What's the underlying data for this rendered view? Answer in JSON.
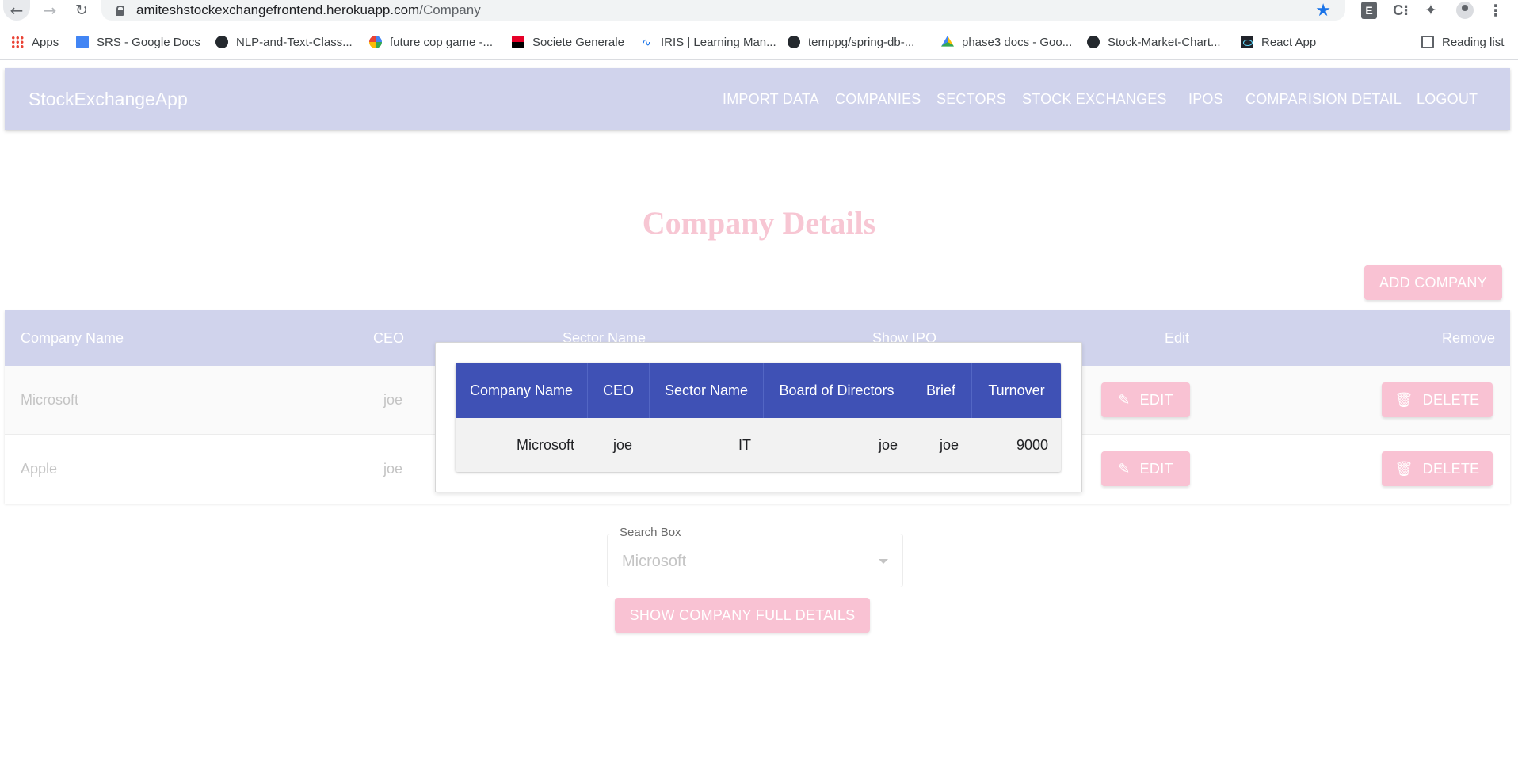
{
  "browser": {
    "url_host": "amiteshstockexchangefrontend.herokuapp.com",
    "url_path": "/Company",
    "extensions": [
      "E",
      "C⁝"
    ],
    "bookmarks": [
      {
        "label": "Apps",
        "icon": "apps-icon"
      },
      {
        "label": "SRS - Google Docs",
        "icon": "google-docs-icon"
      },
      {
        "label": "NLP-and-Text-Class...",
        "icon": "github-icon"
      },
      {
        "label": "future cop game -...",
        "icon": "google-icon"
      },
      {
        "label": "Societe Generale",
        "icon": "societe-generale-icon"
      },
      {
        "label": "IRIS | Learning Man...",
        "icon": "iris-icon"
      },
      {
        "label": "temppg/spring-db-...",
        "icon": "github-icon"
      },
      {
        "label": "phase3 docs - Goo...",
        "icon": "google-drive-icon"
      },
      {
        "label": "Stock-Market-Chart...",
        "icon": "github-icon"
      },
      {
        "label": "React App",
        "icon": "react-icon"
      }
    ],
    "reading_list": "Reading list"
  },
  "app": {
    "brand": "StockExchangeApp",
    "nav": [
      "IMPORT DATA",
      "COMPANIES",
      "SECTORS",
      "STOCK EXCHANGES",
      "IPOS",
      "COMPARISION DETAIL",
      "LOGOUT"
    ],
    "accent_color": "#d0d3ec",
    "button_color": "#f9c2d3"
  },
  "page": {
    "title": "Company Details",
    "add_button": "ADD COMPANY"
  },
  "table": {
    "headers": [
      "Company Name",
      "CEO",
      "Sector Name",
      "Show IPO",
      "Edit",
      "Remove"
    ],
    "rows": [
      {
        "company": "Microsoft",
        "ceo": "joe",
        "edit": "EDIT",
        "delete": "DELETE"
      },
      {
        "company": "Apple",
        "ceo": "joe",
        "edit": "EDIT",
        "delete": "DELETE"
      }
    ]
  },
  "modal": {
    "header_color": "#3f51b5",
    "headers": [
      "Company Name",
      "CEO",
      "Sector Name",
      "Board of Directors",
      "Brief",
      "Turnover"
    ],
    "row": [
      "Microsoft",
      "joe",
      "IT",
      "joe",
      "joe",
      "9000"
    ]
  },
  "search": {
    "label": "Search Box",
    "value": "Microsoft",
    "show_button": "SHOW COMPANY FULL DETAILS"
  }
}
